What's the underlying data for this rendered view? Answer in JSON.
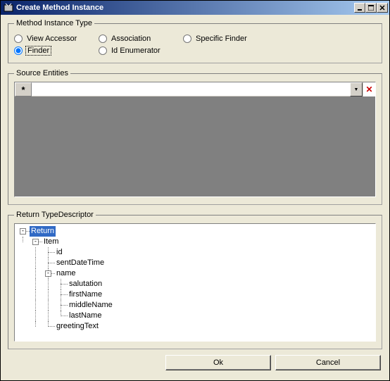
{
  "window": {
    "title": "Create Method Instance"
  },
  "method_instance_type": {
    "legend": "Method Instance Type",
    "options": {
      "view_accessor": "View Accessor",
      "association": "Association",
      "specific_finder": "Specific Finder",
      "finder": "Finder",
      "id_enumerator": "Id Enumerator"
    },
    "selected": "finder"
  },
  "source_entities": {
    "legend": "Source Entities",
    "rows": [
      {
        "value": ""
      }
    ]
  },
  "return_type": {
    "legend": "Return TypeDescriptor",
    "selected": "Return",
    "tree": {
      "root": "Return",
      "item": "Item",
      "id": "id",
      "sentDateTime": "sentDateTime",
      "name": "name",
      "salutation": "salutation",
      "firstName": "firstName",
      "middleName": "middleName",
      "lastName": "lastName",
      "greetingText": "greetingText"
    }
  },
  "buttons": {
    "ok": "Ok",
    "cancel": "Cancel"
  },
  "glyphs": {
    "asterisk": "*",
    "minus": "-",
    "dropdown": "▼",
    "delete": "✕"
  }
}
